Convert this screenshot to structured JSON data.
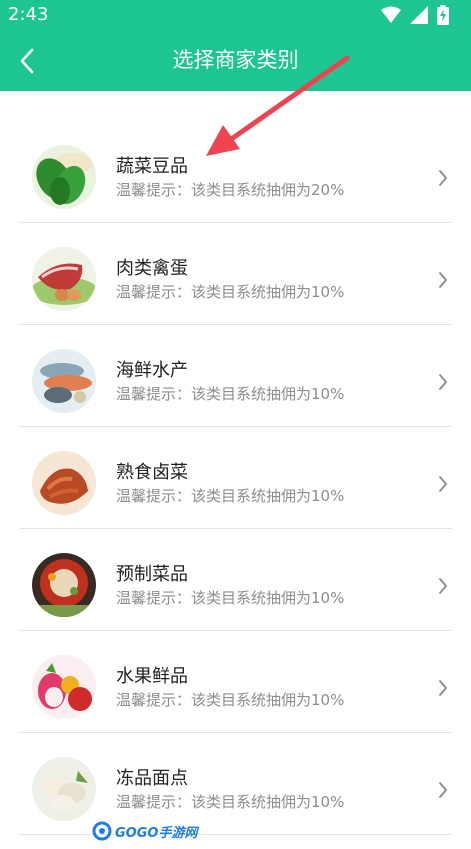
{
  "status_bar": {
    "time": "2:43",
    "icons": [
      "wifi-icon",
      "signal-icon",
      "battery-charging-icon"
    ]
  },
  "header": {
    "title": "选择商家类别",
    "back_icon": "back-chevron-icon",
    "background_color": "#1dc592"
  },
  "categories": [
    {
      "name": "蔬菜豆品",
      "hint": "温馨提示：该类目系统抽佣为20%"
    },
    {
      "name": "肉类禽蛋",
      "hint": "温馨提示：该类目系统抽佣为10%"
    },
    {
      "name": "海鲜水产",
      "hint": "温馨提示：该类目系统抽佣为10%"
    },
    {
      "name": "熟食卤菜",
      "hint": "温馨提示：该类目系统抽佣为10%"
    },
    {
      "name": "预制菜品",
      "hint": "温馨提示：该类目系统抽佣为10%"
    },
    {
      "name": "水果鲜品",
      "hint": "温馨提示：该类目系统抽佣为10%"
    },
    {
      "name": "冻品面点",
      "hint": "温馨提示：该类目系统抽佣为10%"
    }
  ],
  "annotation": {
    "color": "#ee4450"
  },
  "watermark": {
    "text": "GOGO手游网"
  }
}
